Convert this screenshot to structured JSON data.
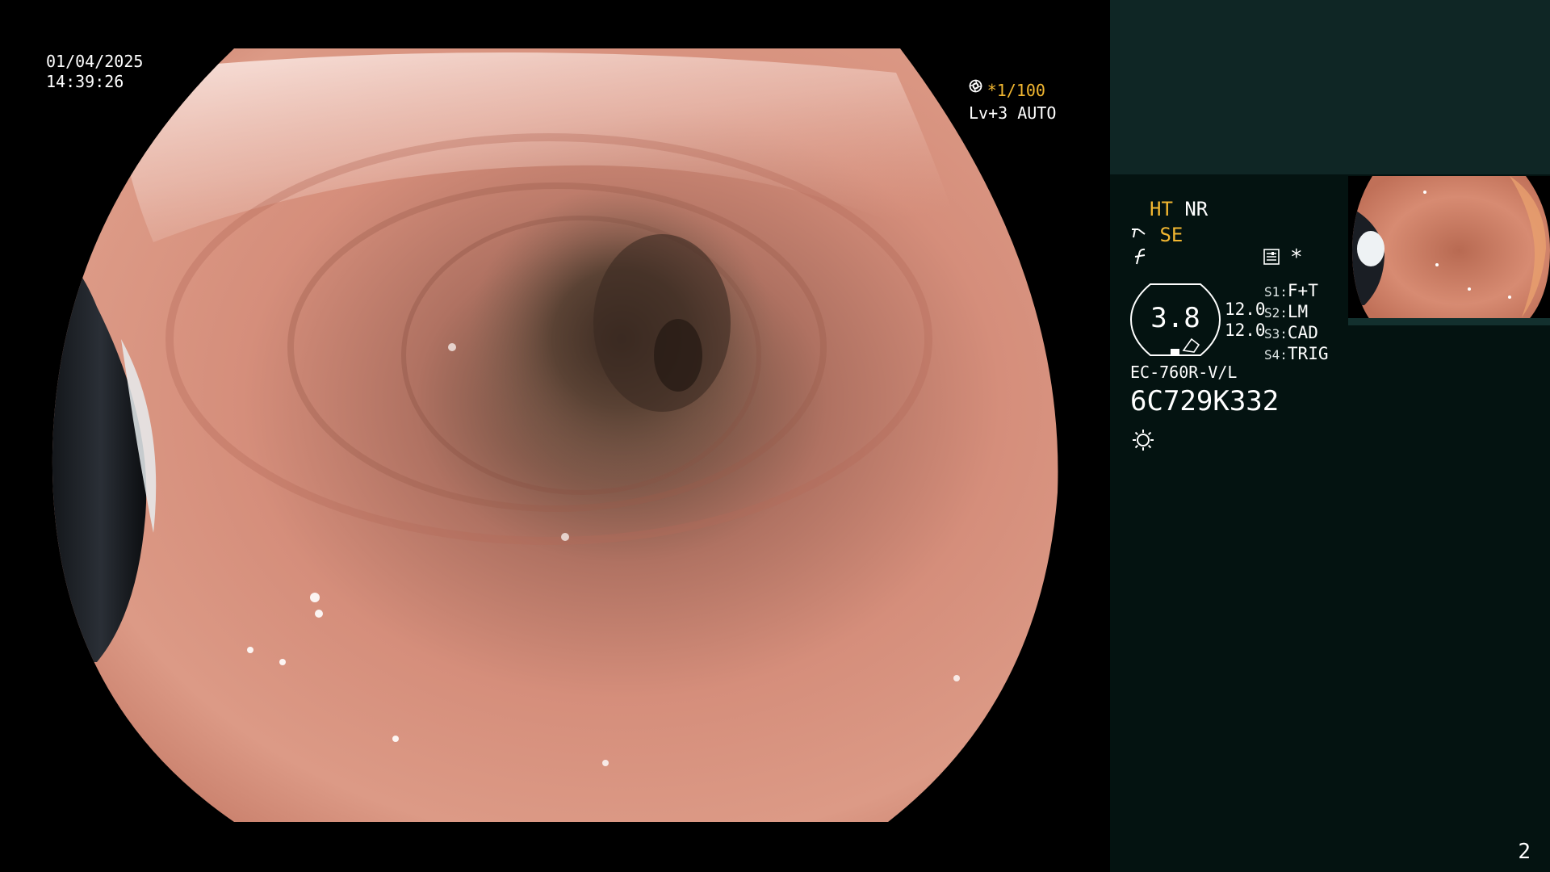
{
  "overlay": {
    "date": "01/04/2025",
    "time": "14:39:26",
    "shutter": "*1/100",
    "shutter_icon": "aperture-icon",
    "level": "Lv+3 AUTO",
    "level_icon": "iris-icon"
  },
  "settings": {
    "ht": "HT",
    "nr": "NR",
    "se": "SE",
    "se_icon": "scope-tip-icon",
    "freeze_icon": "freeze-f-icon",
    "menu_icon": "settings-panel-icon",
    "star": "*",
    "zoom_value": "3.8",
    "val_top": "12.0",
    "val_bottom": "12.0",
    "s1_label": "S1:",
    "s1_value": "F+T",
    "s2_label": "S2:",
    "s2_value": "LM",
    "s3_label": "S3:",
    "s3_value": "CAD",
    "s4_label": "S4:",
    "s4_value": "TRIG"
  },
  "scope": {
    "model": "EC-760R-V/L",
    "serial": "6C729K332",
    "light_icon": "light-icon"
  },
  "thumbnail": {
    "label": "captured-image-thumbnail"
  },
  "page_number": "2",
  "colors": {
    "accent_amber": "#f2b731",
    "panel_top": "#0f2625",
    "panel_bottom": "#041311"
  }
}
